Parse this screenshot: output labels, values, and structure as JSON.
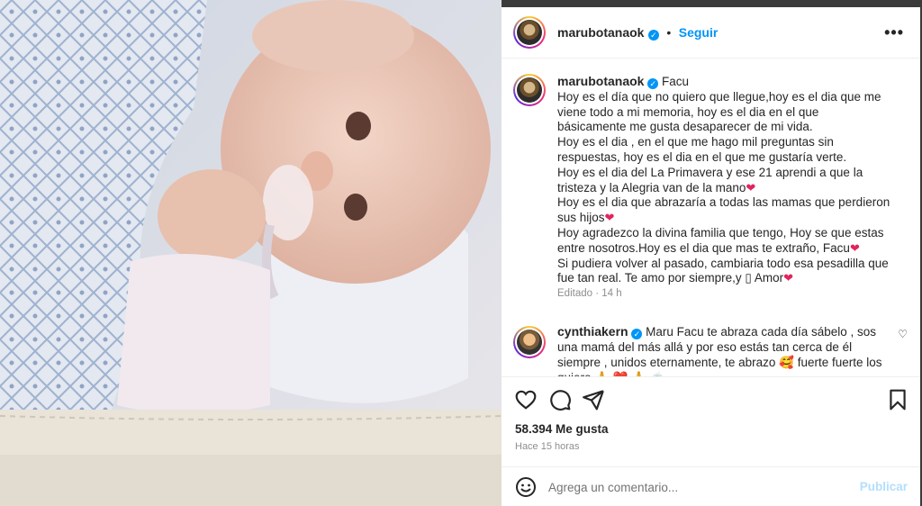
{
  "post": {
    "author": "marubotanaok",
    "follow_label": "Seguir",
    "separator": "•",
    "more_label": "•••"
  },
  "caption": {
    "author": "marubotanaok",
    "lines": [
      "Facu",
      "Hoy es el día que no quiero que llegue,hoy es el dia que me viene todo a mi memoria, hoy es el dia en el que básicamente me gusta desaparecer de mi vida.",
      "Hoy es el dia , en el que me hago mil preguntas sin respuestas, hoy es el dia en el que me gustaría verte.",
      "Hoy es el dia del La Primavera y ese 21 aprendi a que la tristeza y la Alegria van de la mano",
      "Hoy es el dia que abrazaría a todas las mamas que perdieron sus hijos",
      "Hoy agradezco la divina familia que tengo, Hoy se que estas entre nosotros.Hoy es el dia que mas te extraño, Facu",
      "Si pudiera volver al pasado, cambiaria todo esa pesadilla que fue tan real. Te amo por siempre,y ",
      "Amor"
    ],
    "heart": "❤",
    "missing_glyph": "▯",
    "meta": "Editado · 14 h"
  },
  "comment": {
    "author": "cynthiakern",
    "text": "Maru Facu te abraza cada día sábelo , sos una mamá del más allá y por eso estás tan cerca de él siempre , unidos eternamente, te abrazo",
    "text2": "fuerte fuerte los quiero",
    "emoji_face": "🥰",
    "emoji_pray": "🙏",
    "emoji_tail": "❤️ 🙏 🍵",
    "like_icon": "♡"
  },
  "stats": {
    "likes": "58.394 Me gusta",
    "time": "Hace 15 horas"
  },
  "composer": {
    "placeholder": "Agrega un comentario...",
    "publish": "Publicar"
  },
  "colors": {
    "accent": "#0095f6",
    "heart": "#e0245e",
    "publish_disabled": "#b2dffc"
  }
}
